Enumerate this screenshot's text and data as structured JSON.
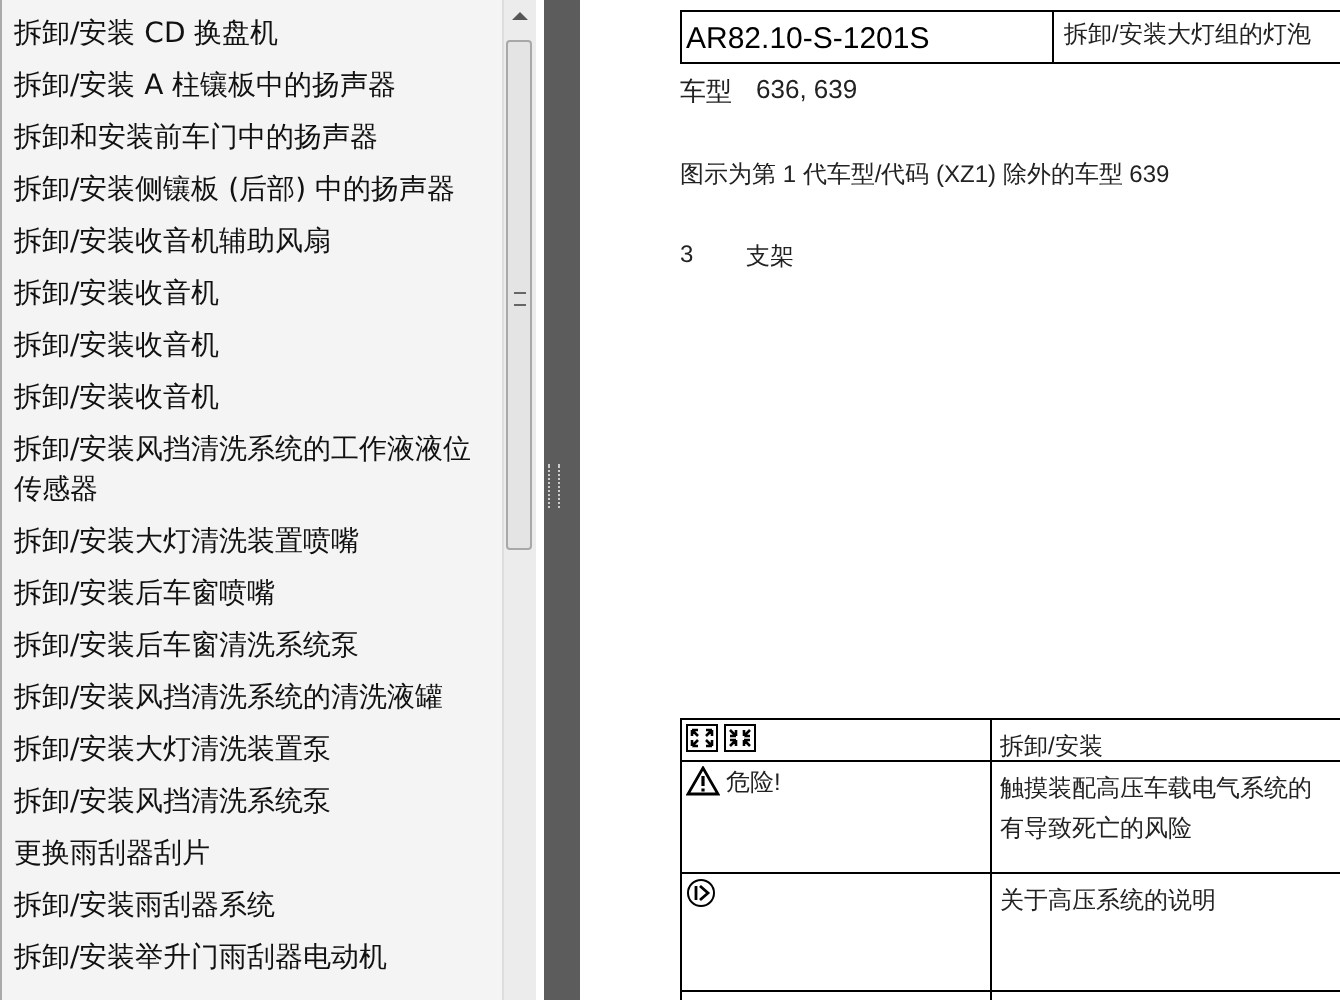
{
  "toc": {
    "items": [
      {
        "label": "拆卸/安装 CD 换盘机"
      },
      {
        "label": "拆卸/安装 A 柱镶板中的扬声器"
      },
      {
        "label": "拆卸和安装前车门中的扬声器"
      },
      {
        "label": "拆卸/安装侧镶板 (后部) 中的扬声器"
      },
      {
        "label": "拆卸/安装收音机辅助风扇"
      },
      {
        "label": "拆卸/安装收音机"
      },
      {
        "label": "拆卸/安装收音机"
      },
      {
        "label": "拆卸/安装收音机"
      },
      {
        "label": "拆卸/安装风挡清洗系统的工作液液位传感器"
      },
      {
        "label": "拆卸/安装大灯清洗装置喷嘴"
      },
      {
        "label": "拆卸/安装后车窗喷嘴"
      },
      {
        "label": "拆卸/安装后车窗清洗系统泵"
      },
      {
        "label": "拆卸/安装风挡清洗系统的清洗液罐"
      },
      {
        "label": "拆卸/安装大灯清洗装置泵"
      },
      {
        "label": "拆卸/安装风挡清洗系统泵"
      },
      {
        "label": "更换雨刮器刮片"
      },
      {
        "label": "拆卸/安装雨刮器系统"
      },
      {
        "label": "拆卸/安装举升门雨刮器电动机"
      }
    ]
  },
  "document": {
    "header": {
      "code": "AR82.10-S-1201S",
      "title": "拆卸/安装大灯组的灯泡"
    },
    "model_label": "车型",
    "models": "636, 639",
    "caption": "图示为第 1 代车型/代码 (XZ1) 除外的车型 639",
    "legend": [
      {
        "number": "3",
        "text": "支架"
      }
    ],
    "notes": [
      {
        "kind": "modes",
        "text": "拆卸/安装"
      },
      {
        "kind": "danger",
        "label": "危险!",
        "text": "触摸装配高压车载电气系统的有导致死亡的风险"
      },
      {
        "kind": "info",
        "text": "关于高压系统的说明"
      },
      {
        "kind": "empty"
      }
    ]
  }
}
